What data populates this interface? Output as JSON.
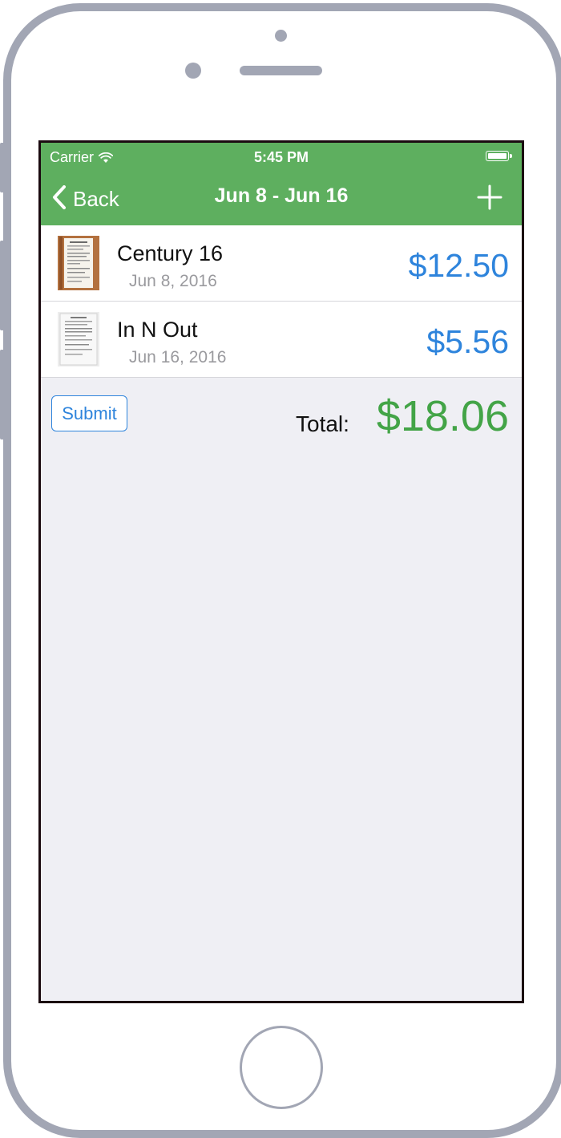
{
  "status_bar": {
    "carrier": "Carrier",
    "time": "5:45 PM",
    "wifi_icon": "wifi-icon",
    "battery_icon": "battery-icon"
  },
  "nav": {
    "back_label": "Back",
    "title": "Jun 8 - Jun 16",
    "add_icon": "plus-icon",
    "back_icon": "chevron-left-icon",
    "bar_color": "#5eaf5f"
  },
  "receipts": [
    {
      "merchant": "Century 16",
      "date": "Jun 8, 2016",
      "amount": "$12.50",
      "thumbnail": "receipt-thumbnail"
    },
    {
      "merchant": "In N Out",
      "date": "Jun 16, 2016",
      "amount": "$5.56",
      "thumbnail": "receipt-thumbnail"
    }
  ],
  "footer": {
    "submit_label": "Submit",
    "total_label": "Total:",
    "total_value": "$18.06"
  },
  "colors": {
    "accent_blue": "#2e84dc",
    "total_green": "#43a447",
    "background": "#efeff4"
  }
}
